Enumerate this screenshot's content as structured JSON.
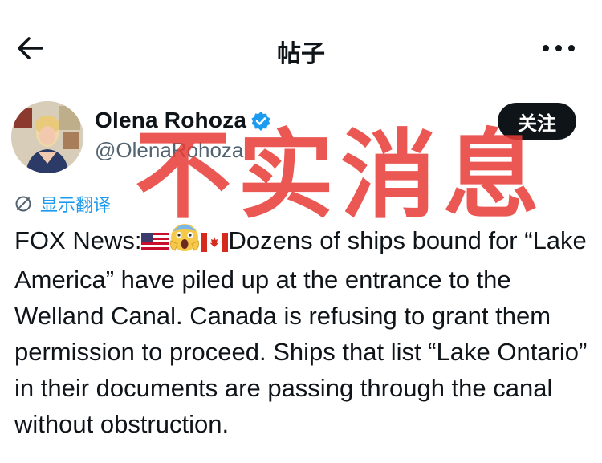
{
  "header": {
    "title": "帖子",
    "back_icon": "arrow-left-icon",
    "more_icon": "more-horizontal-icon"
  },
  "author": {
    "name": "Olena Rohoza",
    "handle": "@OlenaRohoza",
    "verified_icon": "verified-badge-icon",
    "avatar": "avatar"
  },
  "actions": {
    "follow_label": "关注",
    "translate_label": "显示翻译",
    "translate_icon": "globe-icon"
  },
  "overlay": {
    "stamp_text": "不实消息",
    "stamp_color": "#e83c37"
  },
  "post": {
    "prefix": "FOX News:",
    "text": "Dozens of ships bound for “Lake America” have piled up at the entrance to the Welland Canal. Canada is refusing to grant them permission to proceed. Ships that list “Lake Ontario” in their documents are passing through the canal without obstruction."
  },
  "colors": {
    "link": "#1d9bf0",
    "text": "#0f1419",
    "muted": "#536471",
    "verified": "#1d9bf0"
  }
}
